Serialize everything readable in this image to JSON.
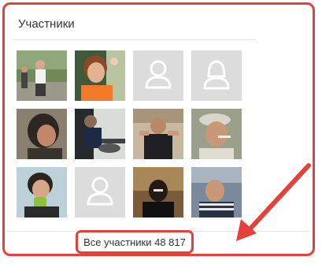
{
  "widget": {
    "title": "Участники",
    "all_members_label": "Все участники 48 817"
  },
  "accent_color": "#e4413a",
  "members": [
    {
      "kind": "photo"
    },
    {
      "kind": "photo"
    },
    {
      "kind": "placeholder"
    },
    {
      "kind": "placeholder"
    },
    {
      "kind": "photo"
    },
    {
      "kind": "photo"
    },
    {
      "kind": "photo"
    },
    {
      "kind": "photo"
    },
    {
      "kind": "photo"
    },
    {
      "kind": "placeholder"
    },
    {
      "kind": "photo"
    },
    {
      "kind": "photo"
    }
  ]
}
